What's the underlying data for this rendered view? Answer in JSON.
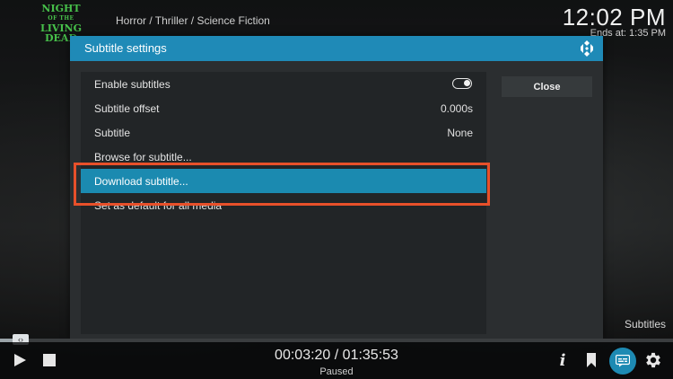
{
  "movie_logo": "NIGHT OF THE LIVING DEAD",
  "header": {
    "genre": "Horror / Thriller / Science Fiction",
    "clock": "12:02 PM",
    "ends_at": "Ends at: 1:35 PM"
  },
  "dialog": {
    "title": "Subtitle settings",
    "close_label": "Close",
    "items": [
      {
        "label": "Enable subtitles",
        "value": "",
        "toggle_on": true
      },
      {
        "label": "Subtitle offset",
        "value": "0.000s"
      },
      {
        "label": "Subtitle",
        "value": "None"
      },
      {
        "label": "Browse for subtitle...",
        "value": ""
      },
      {
        "label": "Download subtitle...",
        "value": "",
        "focused": true
      },
      {
        "label": "Set as default for all media",
        "value": ""
      }
    ]
  },
  "osd": {
    "caption": "Subtitles",
    "time": "00:03:20 / 01:35:53",
    "state": "Paused",
    "progress_fraction": 0.035
  },
  "colors": {
    "accent": "#1f8ab7",
    "highlight_outline": "#e8502a",
    "logo_green": "#47c04a"
  }
}
